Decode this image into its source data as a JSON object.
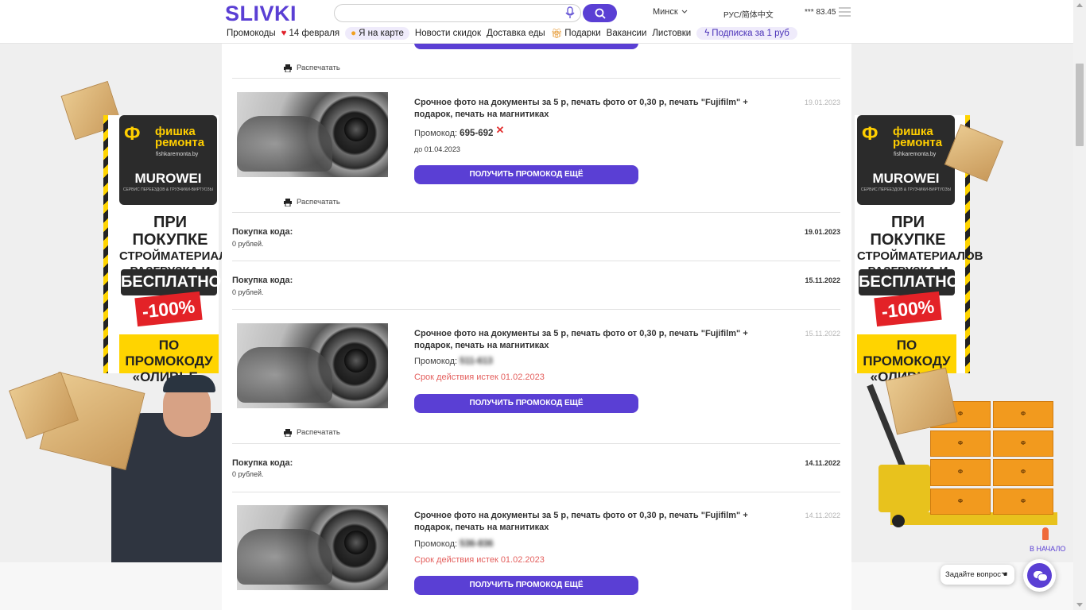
{
  "header": {
    "logo": "SLIVKI",
    "search_placeholder": "",
    "city": "Минск",
    "language": "РУС/简体中文",
    "rate": "*** 83.45"
  },
  "nav": {
    "items": [
      {
        "label": "Промокоды"
      },
      {
        "label": "14 февраля"
      },
      {
        "label": "Я на карте"
      },
      {
        "label": "Новости скидок"
      },
      {
        "label": "Доставка еды"
      },
      {
        "label": "Подарки"
      },
      {
        "label": "Вакансии"
      },
      {
        "label": "Листовки"
      },
      {
        "label": "Подписка за 1 руб"
      }
    ]
  },
  "main": {
    "print_label": "Распечатать",
    "get_code_label": "ПОЛУЧИТЬ ПРОМОКОД ЕЩЁ",
    "promo_label": "Промокод:",
    "until_label": "до",
    "buy_label": "Покупка кода:",
    "buy_price": "0 рублей.",
    "offers": [
      {
        "title": "Срочное фото на документы за 5 р, печать фото от 0,30 р, печать \"Fujifilm\" + подарок, печать на магнитиках",
        "date": "19.01.2023",
        "code": "695-692",
        "valid_until": "01.04.2023"
      },
      {
        "title": "Срочное фото на документы за 5 р, печать фото от 0,30 р, печать \"Fujifilm\" + подарок, печать на магнитиках",
        "date": "15.11.2022",
        "code": "511-613",
        "expired": "Срок действия истек 01.02.2023"
      },
      {
        "title": "Срочное фото на документы за 5 р, печать фото от 0,30 р, печать \"Fujifilm\" + подарок, печать на магнитиках",
        "date": "14.11.2022",
        "code": "536-836",
        "expired": "Срок действия истек 01.02.2023"
      }
    ],
    "purchases": [
      {
        "date": "19.01.2023"
      },
      {
        "date": "15.11.2022"
      },
      {
        "date": "14.11.2022"
      }
    ]
  },
  "banner": {
    "brand": "фишка ремонта",
    "url": "fishkaremonta.by",
    "partner": "MUROWEI",
    "partner_sub": "СЕРВИС ПЕРЕЕЗДОВ & ГРУЗЧИКИ-ВИРТУОЗЫ",
    "line1": "ПРИ ПОКУПКЕ",
    "line2": "СТРОЙМАТЕРИАЛОВ",
    "line3": "РАЗГРУЗКА И ПОДЪЁМ",
    "free": "БЕСПЛАТНО",
    "discount": "-100%",
    "promo_line1": "ПО ПРОМОКОДУ",
    "promo_line2": "«ОЛИВЬЕ»"
  },
  "widgets": {
    "to_top": "В НАЧАЛО",
    "ask": "Задайте вопрос"
  },
  "colors": {
    "accent": "#5a3fd4",
    "expired": "#e4605e",
    "banner_yellow": "#ffd400",
    "banner_red": "#e32227"
  }
}
